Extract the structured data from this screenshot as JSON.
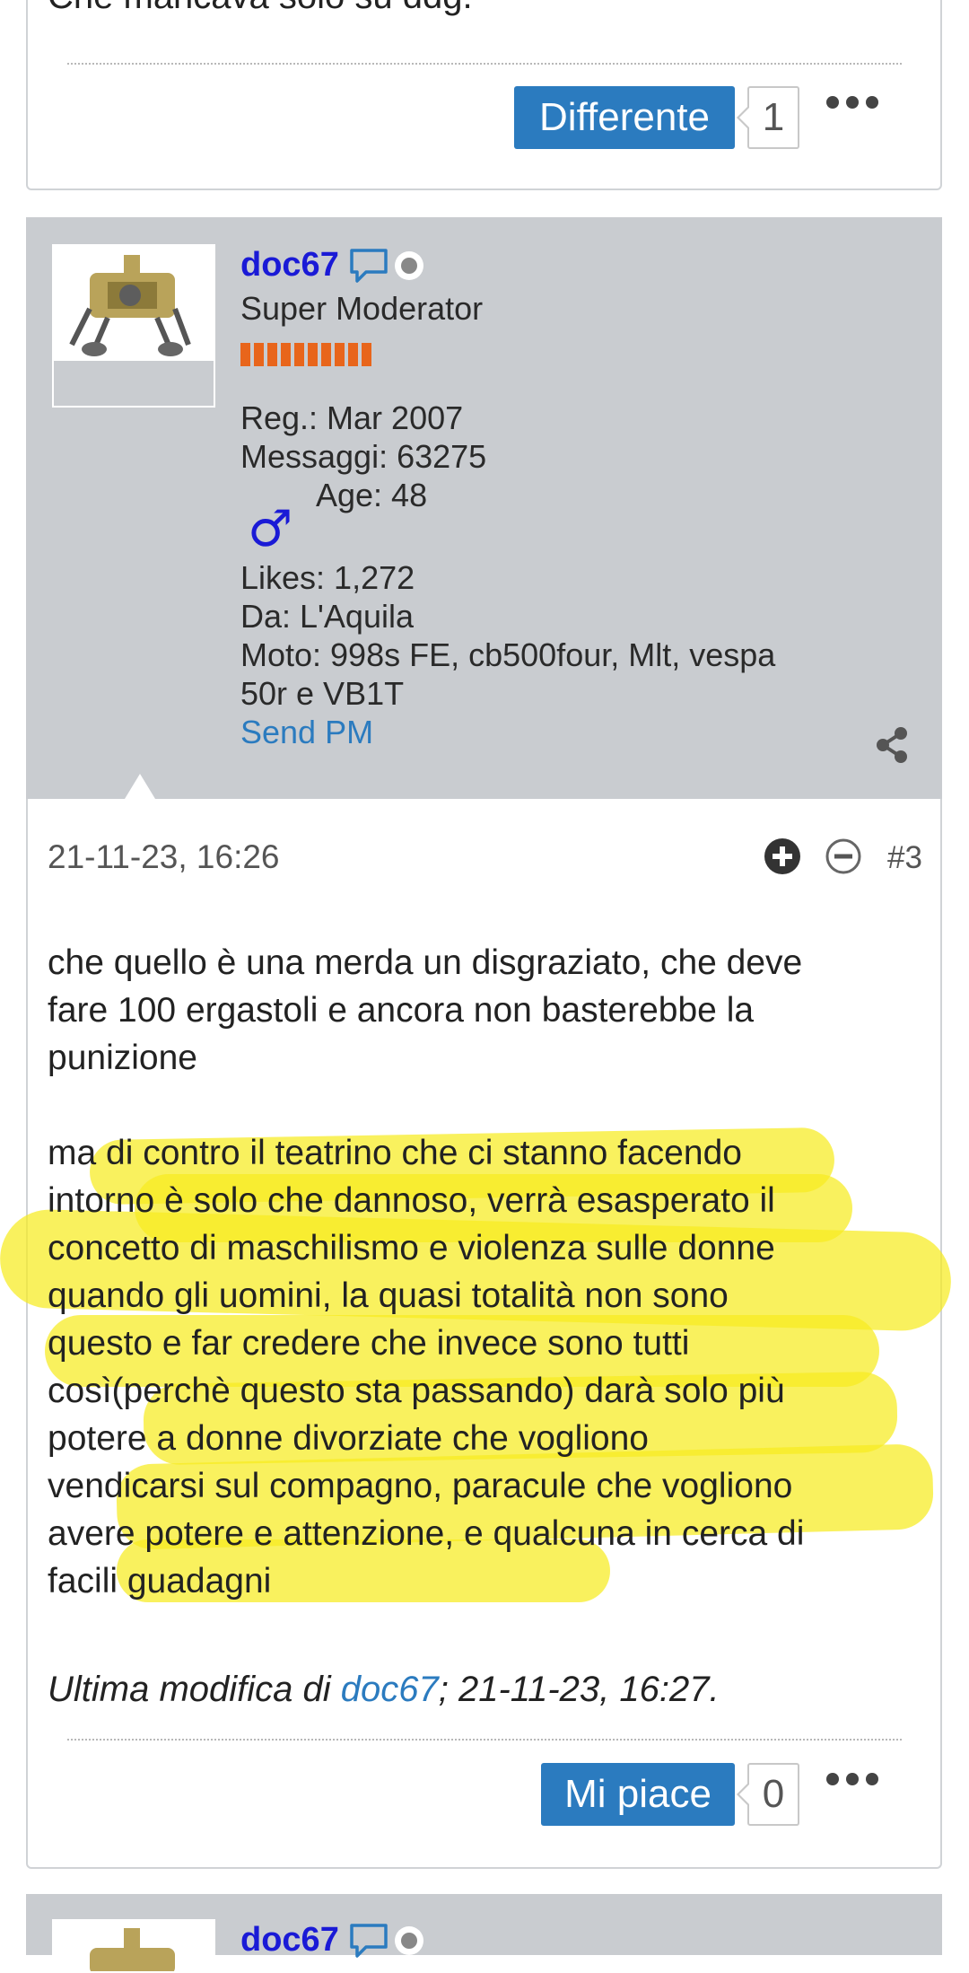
{
  "prev_post": {
    "partial_text": "Che mancava solo su ddg.",
    "reaction_label": "Differente",
    "reaction_count": "1"
  },
  "post": {
    "user": {
      "name": "doc67",
      "role": "Super Moderator",
      "reg": "Reg.: Mar 2007",
      "messages": "Messaggi: 63275",
      "age": "Age: 48",
      "gender_symbol": "♂",
      "likes": "Likes: 1,272",
      "location": "Da: L'Aquila",
      "moto_line1": "Moto: 998s FE, cb500four, Mlt, vespa",
      "moto_line2": "50r e VB1T",
      "send_pm": "Send PM"
    },
    "date": "21-11-23, 16:26",
    "number": "#3",
    "paragraph1": [
      "che quello è una merda un disgraziato, che deve",
      "fare 100 ergastoli e ancora non basterebbe la",
      "punizione"
    ],
    "paragraph2": [
      "ma di contro il teatrino che ci stanno facendo",
      "intorno è solo che dannoso, verrà esasperato il",
      "concetto di maschilismo e violenza sulle donne",
      "quando gli uomini, la quasi totalità non sono",
      "questo e far credere che invece sono tutti",
      "così(perchè questo sta passando) darà solo più",
      "potere a donne divorziate che vogliono",
      "vendicarsi sul compagno, paracule che vogliono",
      "avere potere e attenzione, e qualcuna in cerca di",
      "facili guadagni"
    ],
    "edit_prefix": "Ultima modifica di ",
    "edit_user": "doc67",
    "edit_suffix": "; 21-11-23, 16:27.",
    "reaction_label": "Mi piace",
    "reaction_count": "0"
  },
  "next_post": {
    "user_name": "doc67"
  },
  "colors": {
    "highlight": "#f7ec20",
    "button": "#2b7bbf",
    "username": "#1a1ad6",
    "link": "#2b7bbf",
    "panel": "#c9ccd0"
  },
  "icons": [
    "speech-bubble-icon",
    "offline-status-icon",
    "share-icon",
    "plus-circle-icon",
    "minus-circle-icon",
    "more-dots-icon",
    "male-gender-icon"
  ]
}
